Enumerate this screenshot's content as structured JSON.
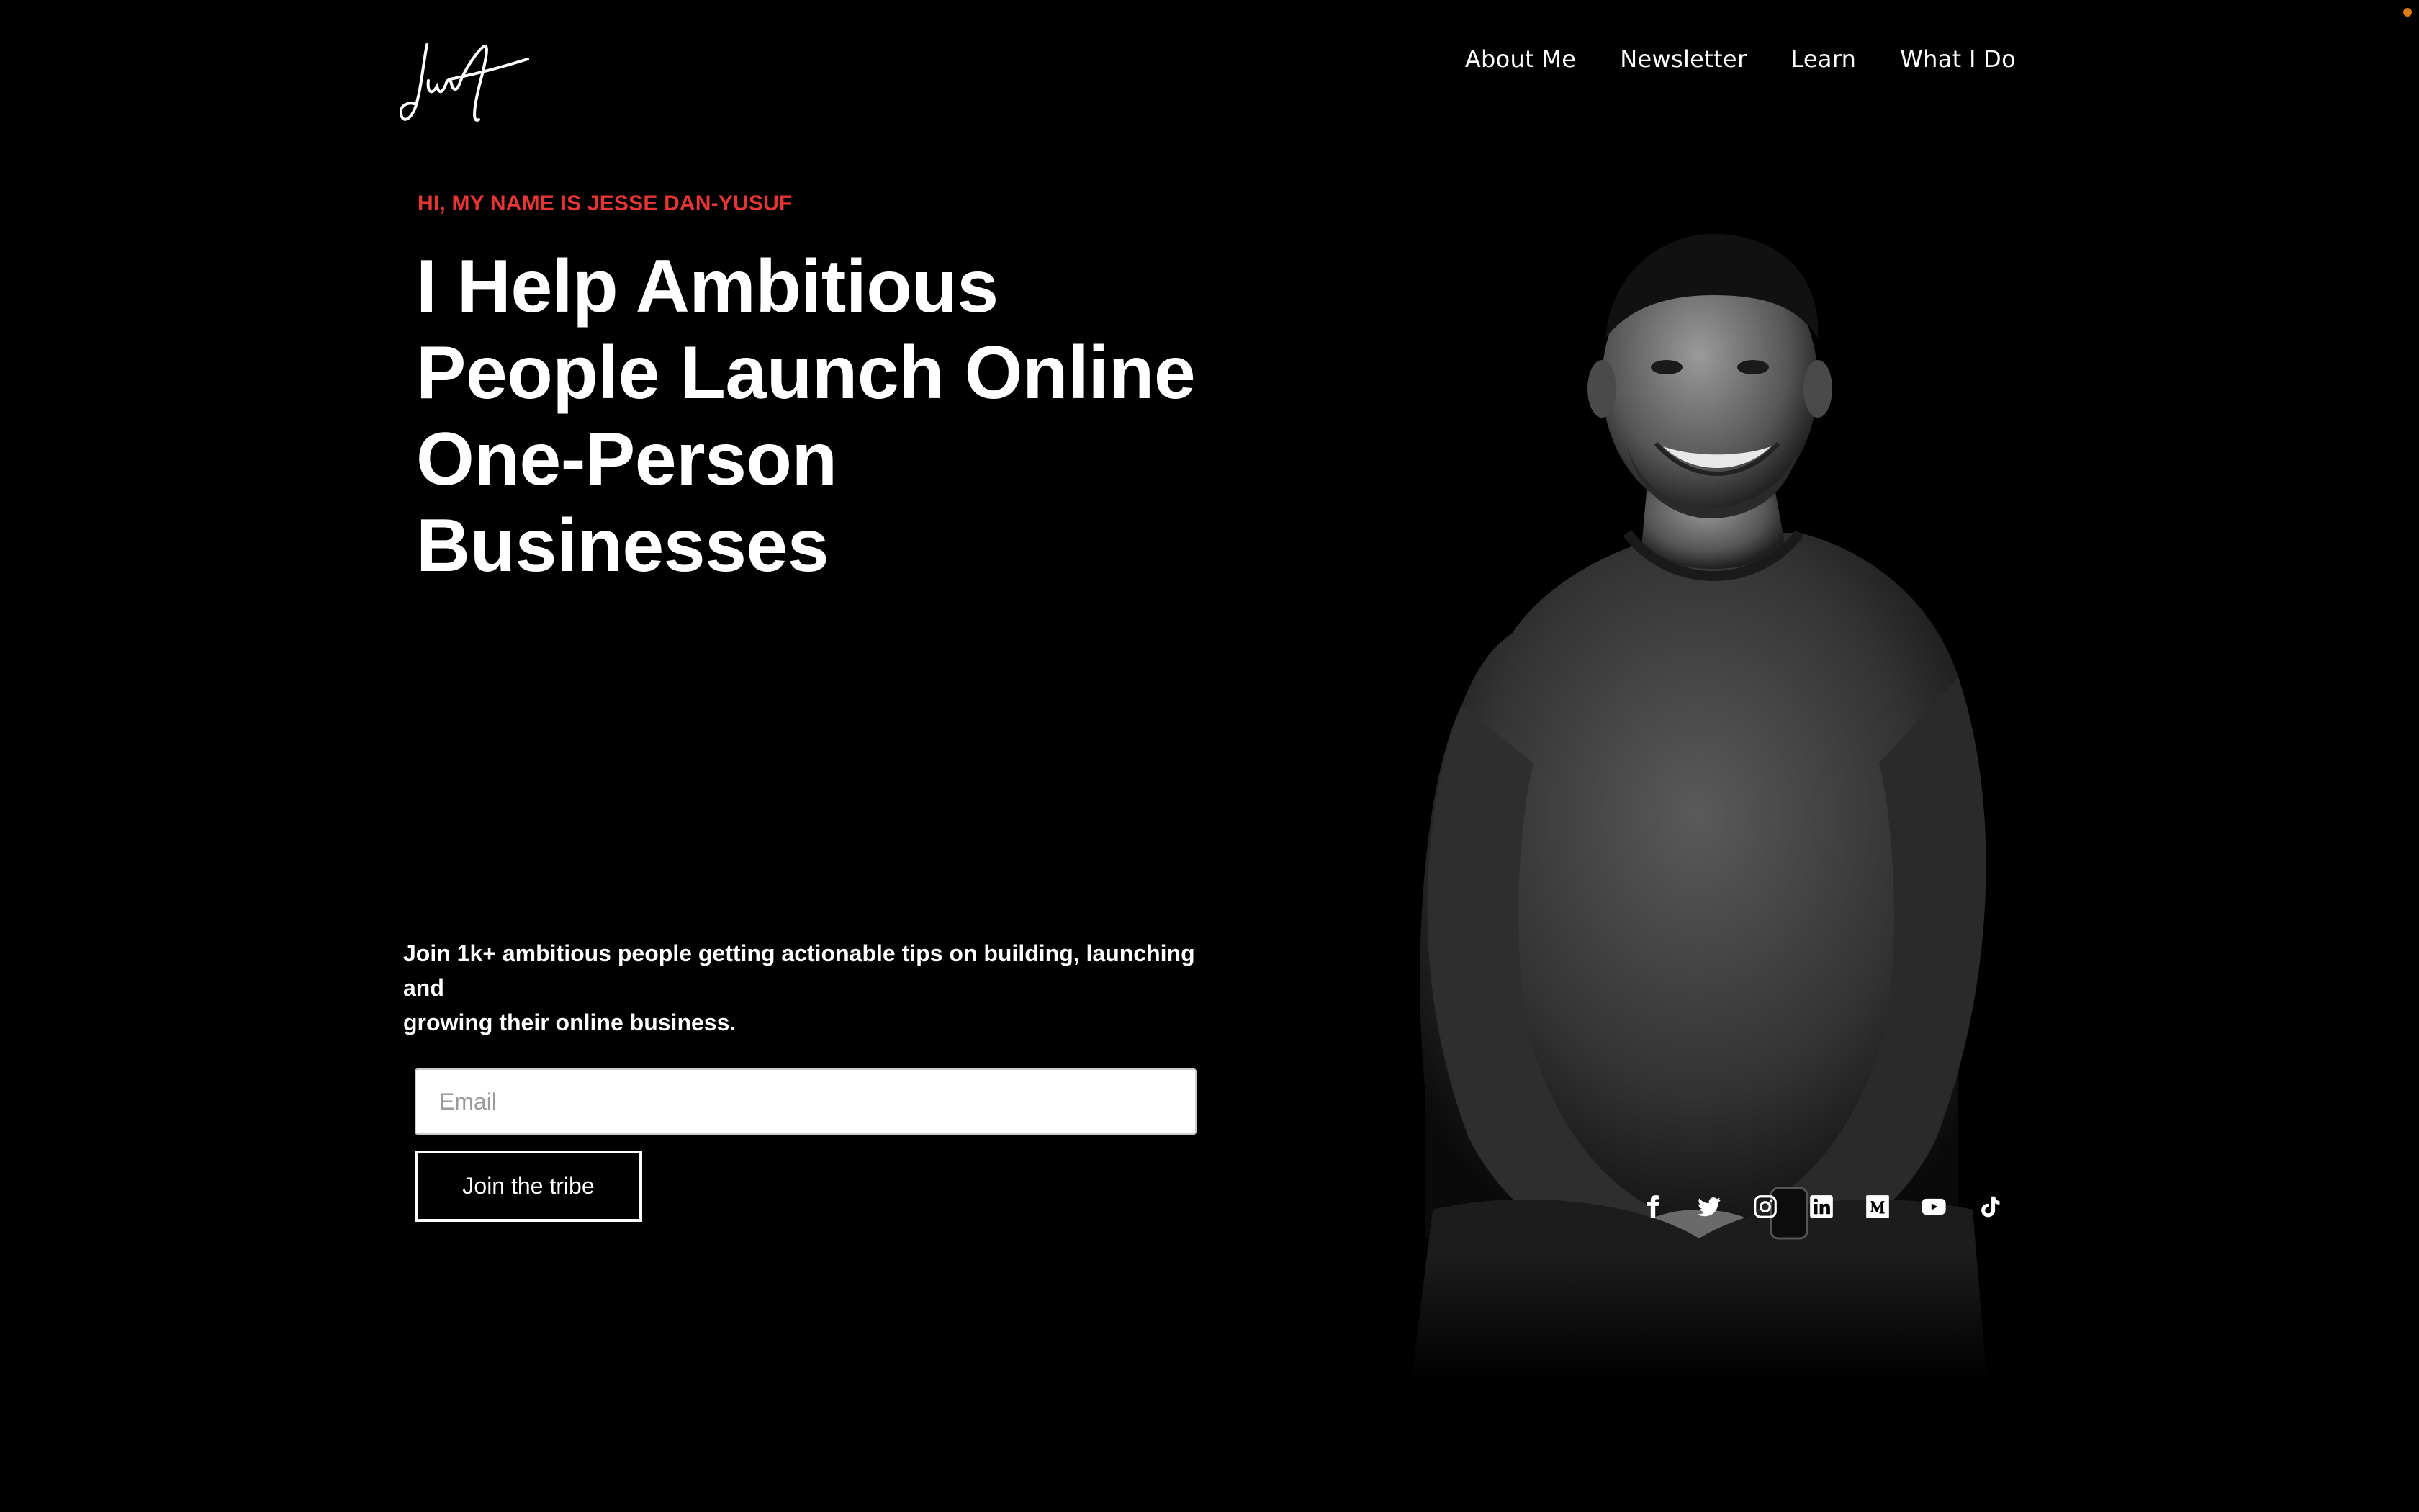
{
  "brand": {
    "logo": "signature-logo"
  },
  "nav": {
    "items": [
      {
        "label": "About Me"
      },
      {
        "label": "Newsletter"
      },
      {
        "label": "Learn"
      },
      {
        "label": "What I Do"
      }
    ]
  },
  "hero": {
    "eyebrow": "HI, MY NAME IS JESSE DAN-YUSUF",
    "headline_lines": [
      "I Help Ambitious",
      "People Launch Online",
      "One-Person",
      "Businesses"
    ],
    "pitch_lines": [
      "Join 1k+ ambitious people getting actionable tips on building, launching and",
      "growing their online business."
    ],
    "email_placeholder": "Email",
    "email_value": "",
    "cta_label": "Join the tribe"
  },
  "socials": [
    {
      "icon": "facebook-icon"
    },
    {
      "icon": "twitter-icon"
    },
    {
      "icon": "instagram-icon"
    },
    {
      "icon": "linkedin-icon"
    },
    {
      "icon": "medium-icon"
    },
    {
      "icon": "youtube-icon"
    },
    {
      "icon": "tiktok-icon"
    }
  ],
  "colors": {
    "background": "#000000",
    "text": "#ffffff",
    "accent": "#e63535"
  }
}
